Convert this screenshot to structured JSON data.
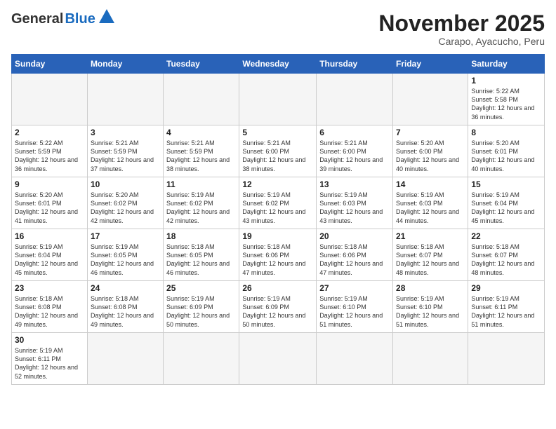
{
  "logo": {
    "general": "General",
    "blue": "Blue"
  },
  "title": {
    "month": "November 2025",
    "location": "Carapo, Ayacucho, Peru"
  },
  "weekdays": [
    "Sunday",
    "Monday",
    "Tuesday",
    "Wednesday",
    "Thursday",
    "Friday",
    "Saturday"
  ],
  "weeks": [
    [
      {
        "day": "",
        "info": ""
      },
      {
        "day": "",
        "info": ""
      },
      {
        "day": "",
        "info": ""
      },
      {
        "day": "",
        "info": ""
      },
      {
        "day": "",
        "info": ""
      },
      {
        "day": "",
        "info": ""
      },
      {
        "day": "1",
        "info": "Sunrise: 5:22 AM\nSunset: 5:58 PM\nDaylight: 12 hours\nand 36 minutes."
      }
    ],
    [
      {
        "day": "2",
        "info": "Sunrise: 5:22 AM\nSunset: 5:59 PM\nDaylight: 12 hours\nand 36 minutes."
      },
      {
        "day": "3",
        "info": "Sunrise: 5:21 AM\nSunset: 5:59 PM\nDaylight: 12 hours\nand 37 minutes."
      },
      {
        "day": "4",
        "info": "Sunrise: 5:21 AM\nSunset: 5:59 PM\nDaylight: 12 hours\nand 38 minutes."
      },
      {
        "day": "5",
        "info": "Sunrise: 5:21 AM\nSunset: 6:00 PM\nDaylight: 12 hours\nand 38 minutes."
      },
      {
        "day": "6",
        "info": "Sunrise: 5:21 AM\nSunset: 6:00 PM\nDaylight: 12 hours\nand 39 minutes."
      },
      {
        "day": "7",
        "info": "Sunrise: 5:20 AM\nSunset: 6:00 PM\nDaylight: 12 hours\nand 40 minutes."
      },
      {
        "day": "8",
        "info": "Sunrise: 5:20 AM\nSunset: 6:01 PM\nDaylight: 12 hours\nand 40 minutes."
      }
    ],
    [
      {
        "day": "9",
        "info": "Sunrise: 5:20 AM\nSunset: 6:01 PM\nDaylight: 12 hours\nand 41 minutes."
      },
      {
        "day": "10",
        "info": "Sunrise: 5:20 AM\nSunset: 6:02 PM\nDaylight: 12 hours\nand 42 minutes."
      },
      {
        "day": "11",
        "info": "Sunrise: 5:19 AM\nSunset: 6:02 PM\nDaylight: 12 hours\nand 42 minutes."
      },
      {
        "day": "12",
        "info": "Sunrise: 5:19 AM\nSunset: 6:02 PM\nDaylight: 12 hours\nand 43 minutes."
      },
      {
        "day": "13",
        "info": "Sunrise: 5:19 AM\nSunset: 6:03 PM\nDaylight: 12 hours\nand 43 minutes."
      },
      {
        "day": "14",
        "info": "Sunrise: 5:19 AM\nSunset: 6:03 PM\nDaylight: 12 hours\nand 44 minutes."
      },
      {
        "day": "15",
        "info": "Sunrise: 5:19 AM\nSunset: 6:04 PM\nDaylight: 12 hours\nand 45 minutes."
      }
    ],
    [
      {
        "day": "16",
        "info": "Sunrise: 5:19 AM\nSunset: 6:04 PM\nDaylight: 12 hours\nand 45 minutes."
      },
      {
        "day": "17",
        "info": "Sunrise: 5:19 AM\nSunset: 6:05 PM\nDaylight: 12 hours\nand 46 minutes."
      },
      {
        "day": "18",
        "info": "Sunrise: 5:18 AM\nSunset: 6:05 PM\nDaylight: 12 hours\nand 46 minutes."
      },
      {
        "day": "19",
        "info": "Sunrise: 5:18 AM\nSunset: 6:06 PM\nDaylight: 12 hours\nand 47 minutes."
      },
      {
        "day": "20",
        "info": "Sunrise: 5:18 AM\nSunset: 6:06 PM\nDaylight: 12 hours\nand 47 minutes."
      },
      {
        "day": "21",
        "info": "Sunrise: 5:18 AM\nSunset: 6:07 PM\nDaylight: 12 hours\nand 48 minutes."
      },
      {
        "day": "22",
        "info": "Sunrise: 5:18 AM\nSunset: 6:07 PM\nDaylight: 12 hours\nand 48 minutes."
      }
    ],
    [
      {
        "day": "23",
        "info": "Sunrise: 5:18 AM\nSunset: 6:08 PM\nDaylight: 12 hours\nand 49 minutes."
      },
      {
        "day": "24",
        "info": "Sunrise: 5:18 AM\nSunset: 6:08 PM\nDaylight: 12 hours\nand 49 minutes."
      },
      {
        "day": "25",
        "info": "Sunrise: 5:19 AM\nSunset: 6:09 PM\nDaylight: 12 hours\nand 50 minutes."
      },
      {
        "day": "26",
        "info": "Sunrise: 5:19 AM\nSunset: 6:09 PM\nDaylight: 12 hours\nand 50 minutes."
      },
      {
        "day": "27",
        "info": "Sunrise: 5:19 AM\nSunset: 6:10 PM\nDaylight: 12 hours\nand 51 minutes."
      },
      {
        "day": "28",
        "info": "Sunrise: 5:19 AM\nSunset: 6:10 PM\nDaylight: 12 hours\nand 51 minutes."
      },
      {
        "day": "29",
        "info": "Sunrise: 5:19 AM\nSunset: 6:11 PM\nDaylight: 12 hours\nand 51 minutes."
      }
    ],
    [
      {
        "day": "30",
        "info": "Sunrise: 5:19 AM\nSunset: 6:11 PM\nDaylight: 12 hours\nand 52 minutes."
      },
      {
        "day": "",
        "info": ""
      },
      {
        "day": "",
        "info": ""
      },
      {
        "day": "",
        "info": ""
      },
      {
        "day": "",
        "info": ""
      },
      {
        "day": "",
        "info": ""
      },
      {
        "day": "",
        "info": ""
      }
    ]
  ]
}
